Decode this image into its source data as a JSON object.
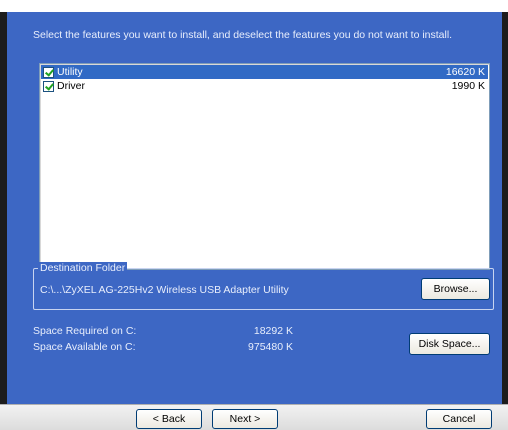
{
  "instructions": "Select the features you want to install, and deselect the features you do not want to install.",
  "features": [
    {
      "name": "Utility",
      "size": "16620 K",
      "checked": true,
      "selected": true
    },
    {
      "name": "Driver",
      "size": "1990 K",
      "checked": true,
      "selected": false
    }
  ],
  "destination": {
    "legend": "Destination Folder",
    "path": "C:\\...\\ZyXEL AG-225Hv2 Wireless USB Adapter Utility",
    "browse_label": "Browse..."
  },
  "space": {
    "required_label": "Space Required on C:",
    "required_value": "18292 K",
    "available_label": "Space Available on C:",
    "available_value": "975480 K",
    "disk_space_label": "Disk Space..."
  },
  "nav": {
    "back_label": "< Back",
    "next_label": "Next >",
    "cancel_label": "Cancel"
  },
  "colors": {
    "panel": "#3d67c4",
    "selection": "#316ac5"
  }
}
